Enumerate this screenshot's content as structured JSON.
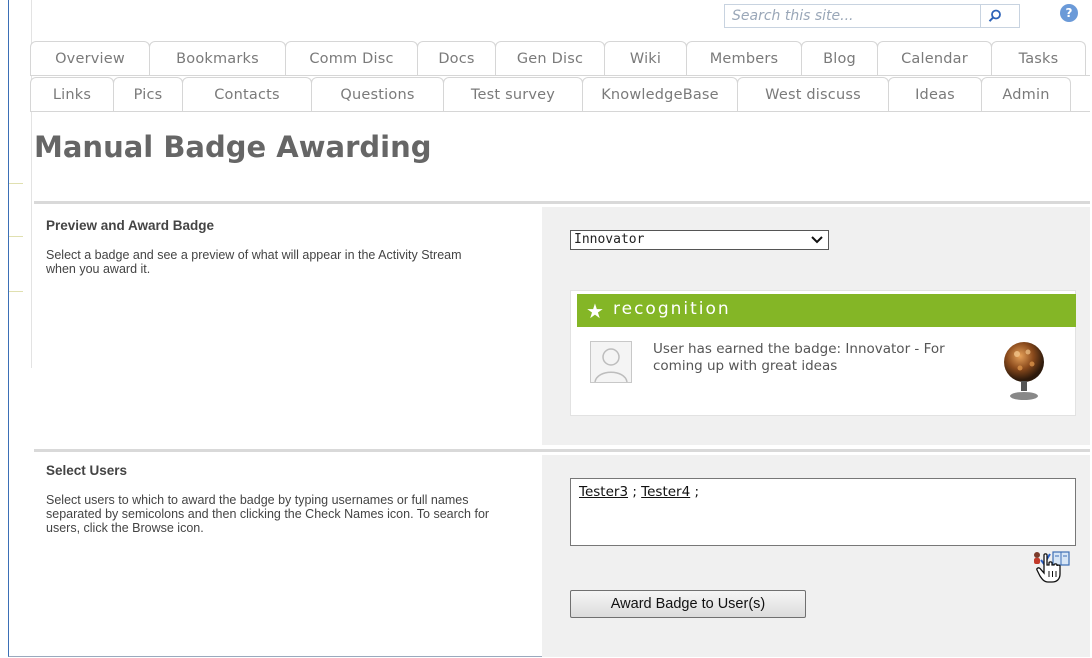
{
  "search": {
    "placeholder": "Search this site..."
  },
  "tabs_row1": [
    "Overview",
    "Bookmarks",
    "Comm Disc",
    "Docs",
    "Gen Disc",
    "Wiki",
    "Members",
    "Blog",
    "Calendar",
    "Tasks"
  ],
  "tabs_row2": [
    "Links",
    "Pics",
    "Contacts",
    "Questions",
    "Test survey",
    "KnowledgeBase",
    "West discuss",
    "Ideas",
    "Admin"
  ],
  "page": {
    "title": "Manual Badge Awarding"
  },
  "preview_section": {
    "title": "Preview and Award Badge",
    "description": "Select a badge and see a preview of what will appear in the Activity Stream when you award it.",
    "selected_badge": "Innovator",
    "card_header": "recognition",
    "card_message": "User has earned the badge: Innovator - For coming up with great ideas"
  },
  "users_section": {
    "title": "Select Users",
    "description": "Select users to which to award the badge by typing usernames or full names separated by semicolons and then clicking the Check Names icon. To search for users, click the Browse icon.",
    "users": [
      "Tester3",
      "Tester4"
    ],
    "award_button": "Award Badge to User(s)"
  },
  "colors": {
    "accent_green": "#84b626",
    "frame_blue": "#3b6fb6",
    "panel_gray": "#f0f0f0"
  },
  "icons": [
    "search-icon",
    "help-icon",
    "chevron-down-icon",
    "star-icon",
    "check-names-icon",
    "browse-icon",
    "hand-cursor-icon"
  ]
}
